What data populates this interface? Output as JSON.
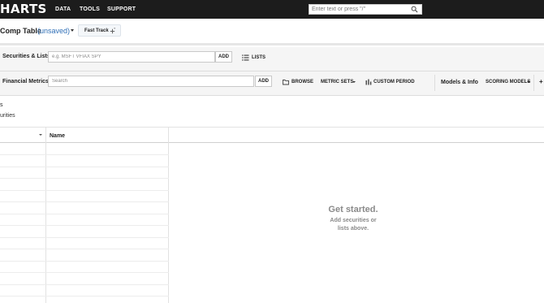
{
  "nav": {
    "logo": "HARTS",
    "links": [
      "DATA",
      "TOOLS",
      "SUPPORT"
    ],
    "search_placeholder": "Enter text or press \"/\""
  },
  "title": {
    "name": "Comp Table",
    "status": "(unsaved)",
    "fast_track_label": "Fast Track"
  },
  "securities": {
    "label": "Securities & Lists",
    "placeholder": "e.g. MSFT VFIAX SPY",
    "add_label": "ADD",
    "lists_label": "LISTS"
  },
  "metrics": {
    "label": "Financial Metrics",
    "placeholder": "Search",
    "add_label": "ADD",
    "browse_label": "BROWSE",
    "metric_sets_label": "METRIC SETS",
    "custom_period_label": "CUSTOM PERIOD",
    "models_label": "Models & Info",
    "scoring_models_label": "SCORING MODELS",
    "more_label": "+"
  },
  "info": {
    "line1": "s",
    "line2": "urities"
  },
  "table": {
    "columns": [
      "",
      "Name"
    ],
    "empty_title": "Get started.",
    "empty_subtitle": "Add securities or\nlists above."
  },
  "colors": {
    "topbar": "#1c1c1c",
    "link_blue": "#2f6fb7",
    "toolbar_bg": "#f5f5f5",
    "empty_text": "#8a8a8a"
  }
}
